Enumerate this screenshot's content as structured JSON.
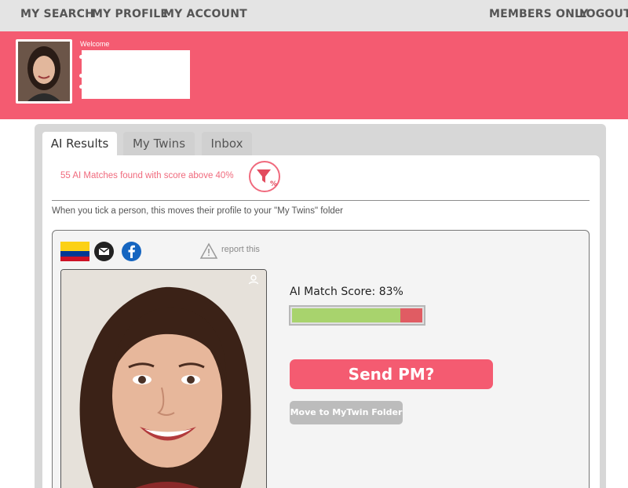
{
  "nav": {
    "search": "MY SEARCH",
    "profile": "MY PROFILE",
    "account": "MY ACCOUNT",
    "members": "MEMBERS ONLY",
    "logout": "LOGOUT"
  },
  "header": {
    "welcome": "Welcome"
  },
  "tabs": [
    {
      "label": "AI Results",
      "active": true
    },
    {
      "label": "My Twins",
      "active": false
    },
    {
      "label": "Inbox",
      "active": false
    }
  ],
  "results": {
    "matches_text": "55 AI Matches found with score above 40%",
    "hint": "When you tick a person, this moves their profile to your \"My Twins\" folder"
  },
  "card": {
    "report": "report this",
    "score_label": "AI Match Score: 83%",
    "score_fraction": 0.83,
    "send_pm": "Send PM?",
    "move": "Move to MyTwin Folder",
    "icons": [
      "colombia-flag",
      "email-icon",
      "facebook-icon",
      "warning-icon",
      "user-icon",
      "filter-percent-icon"
    ]
  },
  "colors": {
    "brand_pink": "#f45b71",
    "score_good": "#a8d36d",
    "score_rest": "#e05c63"
  }
}
